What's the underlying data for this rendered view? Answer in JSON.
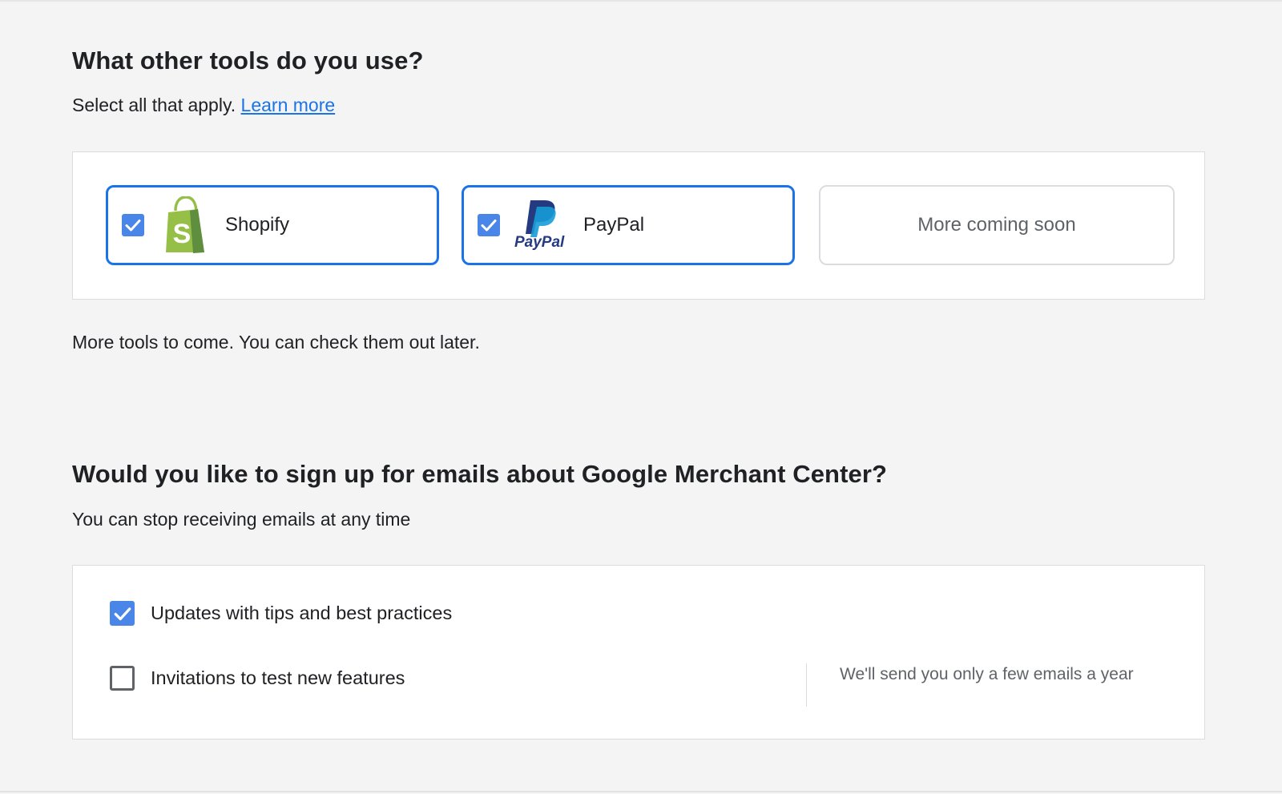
{
  "tools_section": {
    "title": "What other tools do you use?",
    "subtitle": "Select all that apply.",
    "learn_more": "Learn more",
    "options": [
      {
        "label": "Shopify",
        "checked": true,
        "icon": "shopify-bag-icon"
      },
      {
        "label": "PayPal",
        "checked": true,
        "icon": "paypal-logo-icon",
        "logo_text": "PayPal"
      }
    ],
    "coming_soon": "More coming soon",
    "note": "More tools to come. You can check them out later."
  },
  "email_section": {
    "title": "Would you like to sign up for emails about Google Merchant Center?",
    "subtitle": "You can stop receiving emails at any time",
    "options": [
      {
        "label": "Updates with tips and best practices",
        "checked": true
      },
      {
        "label": "Invitations to test new features",
        "checked": false
      }
    ],
    "side_note": "We'll send you only a few emails a year"
  },
  "colors": {
    "accent": "#1a73e8",
    "checkbox_fill": "#4a86e8",
    "shopify_green": "#95bf47",
    "paypal_dark": "#253b80",
    "paypal_light": "#179bd7"
  }
}
